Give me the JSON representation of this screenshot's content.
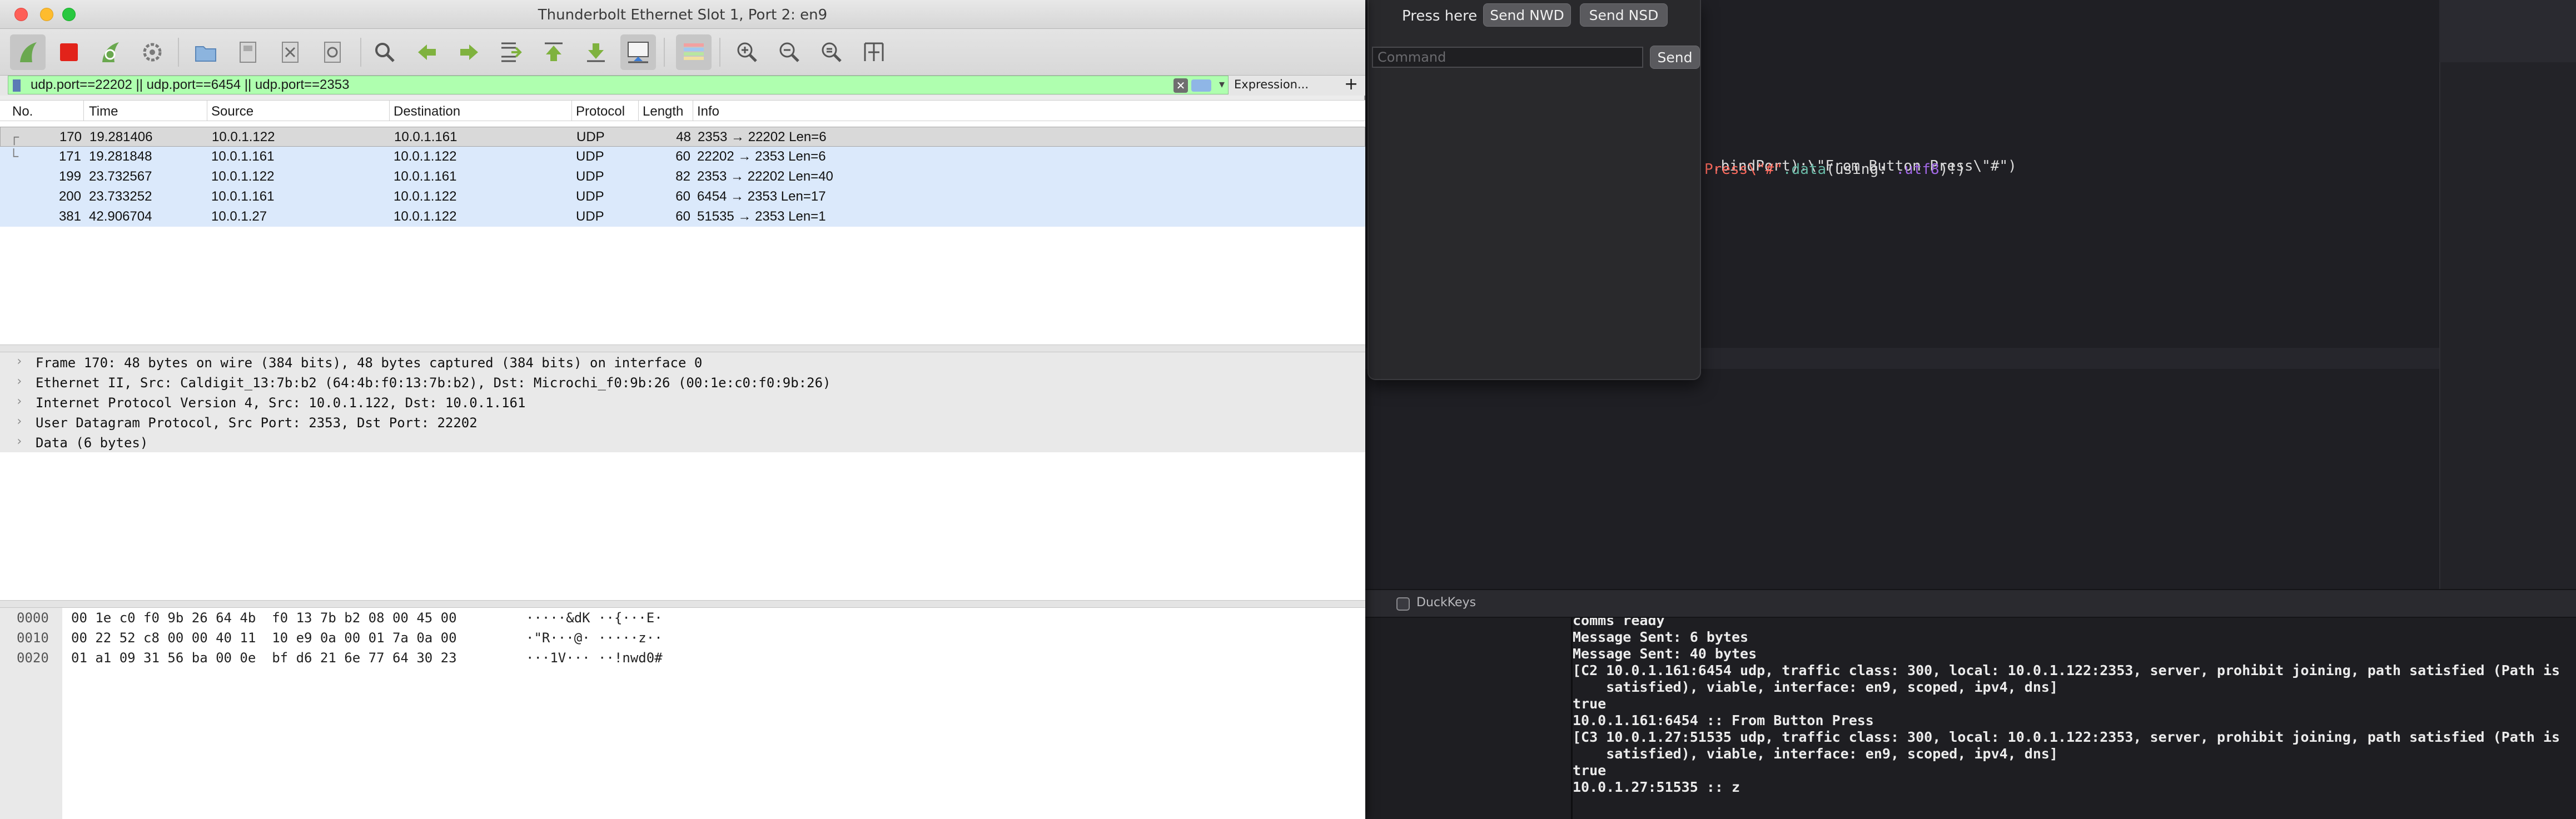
{
  "wireshark": {
    "title": "Thunderbolt Ethernet Slot 1, Port 2: en9",
    "filter": {
      "value": "udp.port==22202 || udp.port==6454 || udp.port==2353",
      "expression_label": "Expression...",
      "plus_label": "+",
      "clear_label": "✕",
      "dropdown_label": "▾"
    },
    "columns": [
      "No.",
      "Time",
      "Source",
      "Destination",
      "Protocol",
      "Length",
      "Info"
    ],
    "packets": [
      {
        "no": "170",
        "time": "19.281406",
        "source": "10.0.1.122",
        "destination": "10.0.1.161",
        "protocol": "UDP",
        "length": "48",
        "info": "2353 → 22202 Len=6"
      },
      {
        "no": "171",
        "time": "19.281848",
        "source": "10.0.1.161",
        "destination": "10.0.1.122",
        "protocol": "UDP",
        "length": "60",
        "info": "22202 → 2353 Len=6"
      },
      {
        "no": "199",
        "time": "23.732567",
        "source": "10.0.1.122",
        "destination": "10.0.1.161",
        "protocol": "UDP",
        "length": "82",
        "info": "2353 → 22202 Len=40"
      },
      {
        "no": "200",
        "time": "23.733252",
        "source": "10.0.1.161",
        "destination": "10.0.1.122",
        "protocol": "UDP",
        "length": "60",
        "info": "6454 → 2353 Len=17"
      },
      {
        "no": "381",
        "time": "42.906704",
        "source": "10.0.1.27",
        "destination": "10.0.1.122",
        "protocol": "UDP",
        "length": "60",
        "info": "51535 → 2353 Len=1"
      }
    ],
    "details": [
      "Frame 170: 48 bytes on wire (384 bits), 48 bytes captured (384 bits) on interface 0",
      "Ethernet II, Src: Caldigit_13:7b:b2 (64:4b:f0:13:7b:b2), Dst: Microchi_f0:9b:26 (00:1e:c0:f0:9b:26)",
      "Internet Protocol Version 4, Src: 10.0.1.122, Dst: 10.0.1.161",
      "User Datagram Protocol, Src Port: 2353, Dst Port: 22202",
      "Data (6 bytes)"
    ],
    "bytes": [
      {
        "offset": "0000",
        "hex": "00 1e c0 f0 9b 26 64 4b  f0 13 7b b2 08 00 45 00",
        "ascii": "·····&dK ··{···E·"
      },
      {
        "offset": "0010",
        "hex": "00 22 52 c8 00 00 40 11  10 e9 0a 00 01 7a 0a 00",
        "ascii": "·\"R···@· ·····z··"
      },
      {
        "offset": "0020",
        "hex": "01 a1 09 31 56 ba 00 0e  bf d6 21 6e 77 64 30 23",
        "ascii": "···1V··· ··!nwd0#"
      }
    ],
    "toolbar_icons": [
      "shark-fin-start-icon",
      "stop-capture-icon",
      "restart-capture-icon",
      "capture-options-icon",
      "open-file-icon",
      "save-file-icon",
      "close-file-icon",
      "reload-file-icon",
      "find-packet-icon",
      "go-back-icon",
      "go-forward-icon",
      "go-to-packet-icon",
      "go-first-icon",
      "go-last-icon",
      "auto-scroll-icon",
      "colorize-icon",
      "zoom-in-icon",
      "zoom-out-icon",
      "normal-size-icon",
      "resize-columns-icon"
    ]
  },
  "sender": {
    "press_label": "Press here",
    "send_nwd_label": "Send NWD",
    "send_nsd_label": "Send NSD",
    "command_placeholder": "Command",
    "send_label": "Send"
  },
  "ide": {
    "code_line1": ".bindPort):\\\"From Button Press\\\"#\")",
    "code_line2_str": "Press\\\"#\"",
    "code_line2_fn": ".data",
    "code_line2_plain1": "(using: ",
    "code_line2_kw": ".utf8",
    "code_line2_plain2": ")!)",
    "duckkeys_label": "DuckKeys",
    "console": [
      "comms ready",
      "Message Sent: 6 bytes",
      "Message Sent: 40 bytes",
      "[C2 10.0.1.161:6454 udp, traffic class: 300, local: 10.0.1.122:2353, server, prohibit joining, path satisfied (Path is",
      "    satisfied), viable, interface: en9, scoped, ipv4, dns]",
      "true",
      "10.0.1.161:6454 :: From Button Press",
      "[C3 10.0.1.27:51535 udp, traffic class: 300, local: 10.0.1.122:2353, server, prohibit joining, path satisfied (Path is",
      "    satisfied), viable, interface: en9, scoped, ipv4, dns]",
      "true",
      "10.0.1.27:51535 :: z"
    ]
  },
  "colors": {
    "filter_valid": "#afffaf",
    "row_highlight": "#dbe9fb",
    "ide_background": "#1f1f24",
    "code_string": "#fc6a5d",
    "code_keyword": "#a167e6"
  }
}
